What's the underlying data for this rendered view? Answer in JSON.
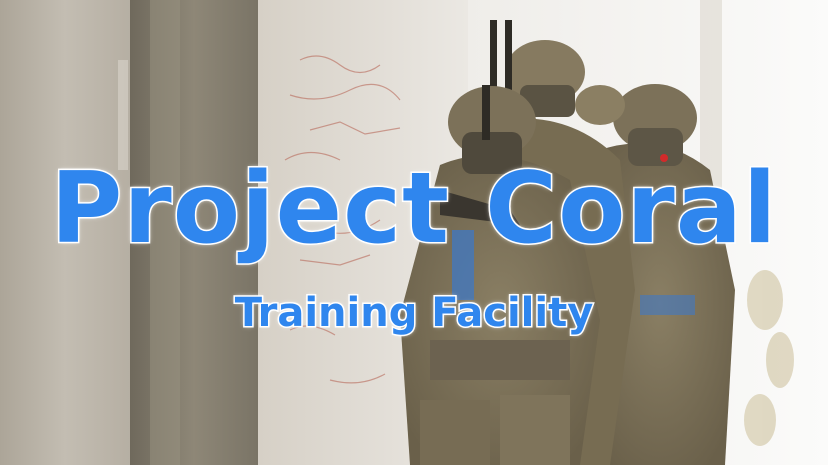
{
  "title": {
    "main": "Project Coral",
    "subtitle": "Training Facility"
  },
  "colors": {
    "title_fill": "#2f86ee",
    "title_outline": "#ffffff",
    "camo_base": "#7d7258",
    "helmet": "#7c7159",
    "wall_light": "#f3f1ee",
    "wall_concrete": "#b9b3a9",
    "door_frame": "#8b8474",
    "accent_blue_strap": "#3f78c4",
    "red_dot": "#d22a2a"
  },
  "scene": {
    "subject_icons": [
      "soldier-figure-icon",
      "helmet-icon",
      "rifle-icon"
    ]
  }
}
